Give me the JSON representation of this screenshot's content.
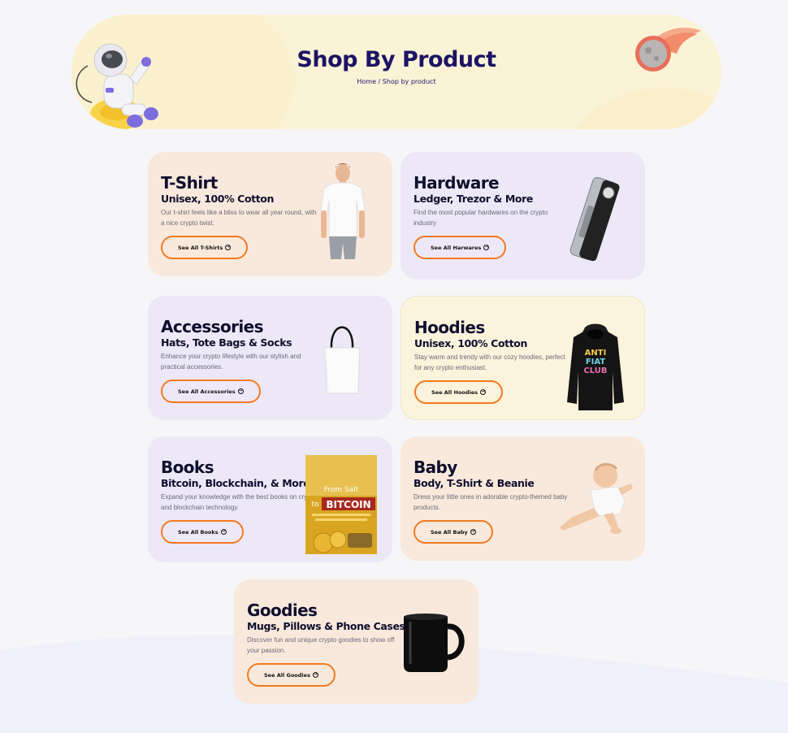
{
  "header": {
    "title": "Shop By Product",
    "breadcrumb_home": "Home",
    "breadcrumb_sep": " / ",
    "breadcrumb_current": "Shop by product"
  },
  "cards": [
    {
      "title": "T-Shirt",
      "subtitle": "Unisex, 100% Cotton",
      "desc": "Our t-shirt feels like a bliss to wear all year round, with a nice crypto twist.",
      "button": "See All T-Shirts"
    },
    {
      "title": "Hardware",
      "subtitle": "Ledger, Trezor & More",
      "desc": "Find the most popular hardwares on the crypto industry",
      "button": "See All Harwares"
    },
    {
      "title": "Accessories",
      "subtitle": "Hats, Tote Bags & Socks",
      "desc": "Enhance your crypto lifestyle with our stylish and practical accessories.",
      "button": "See All Accessories"
    },
    {
      "title": "Hoodies",
      "subtitle": "Unisex, 100% Cotton",
      "desc": "Stay warm and trendy with our cozy hoodies, perfect for any crypto enthusiast.",
      "button": "See All Hoodies"
    },
    {
      "title": "Books",
      "subtitle": "Bitcoin, Blockchain, & More",
      "desc": "Expand your knowledge with the best books on crypto and blockchain technology.",
      "button": "See All Books"
    },
    {
      "title": "Baby",
      "subtitle": "Body, T-Shirt & Beanie",
      "desc": "Dress your little ones in adorable crypto-themed baby products.",
      "button": "See All Baby"
    },
    {
      "title": "Goodies",
      "subtitle": "Mugs, Pillows & Phone Cases",
      "desc": "Discover fun and unique crypto goodies to show off your passion.",
      "button": "See All Goodies"
    }
  ],
  "products": {
    "hoodie_print": [
      "ANTI",
      "FIAT",
      "CLUB"
    ],
    "book_line1": "From Salt",
    "book_line2": "to",
    "book_line3": "BITCOIN"
  },
  "colors": {
    "accent": "#f47a20",
    "title": "#1b1464",
    "peach": "#f9e9dc",
    "lavender": "#ede8f7",
    "cream": "#fbf3dc",
    "banner": "#fbf3d6"
  },
  "icons": [
    "astronaut-illustration",
    "meteor-illustration",
    "arrow-circle-right-icon"
  ]
}
